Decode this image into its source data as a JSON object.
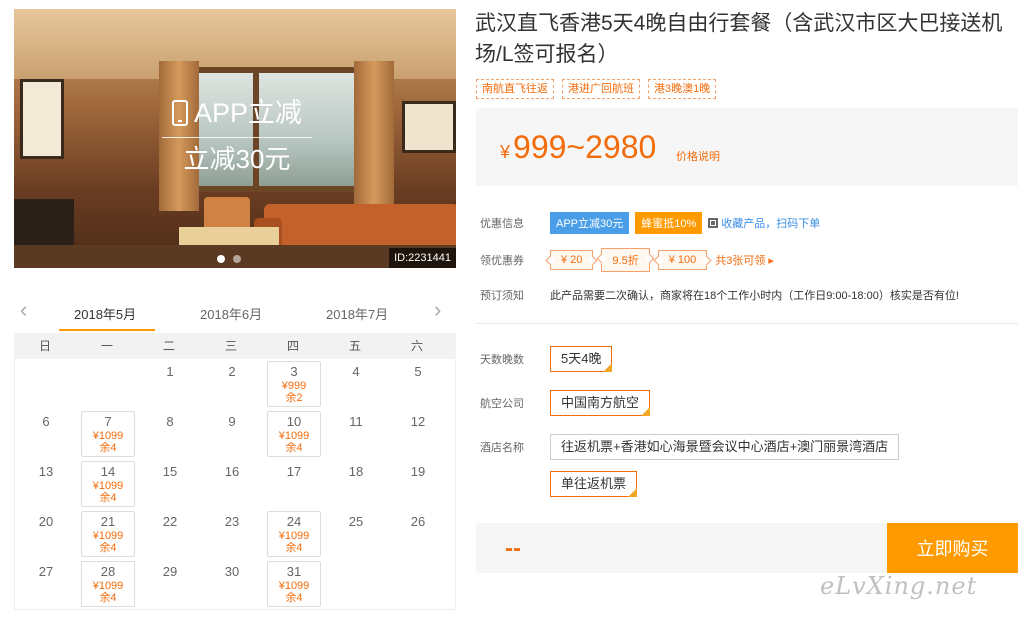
{
  "hero": {
    "promo_line1": "APP立减",
    "promo_line2": "立减30元",
    "product_id": "ID:2231441",
    "slides": 2,
    "active_slide": 0
  },
  "calendar": {
    "months": [
      "2018年5月",
      "2018年6月",
      "2018年7月"
    ],
    "active_month": 0,
    "weekdays": [
      "日",
      "一",
      "二",
      "三",
      "四",
      "五",
      "六"
    ],
    "days": [
      {
        "day": "",
        "price": "",
        "left": ""
      },
      {
        "day": "",
        "price": "",
        "left": ""
      },
      {
        "day": "1",
        "price": "",
        "left": ""
      },
      {
        "day": "2",
        "price": "",
        "left": ""
      },
      {
        "day": "3",
        "price": "¥999",
        "left": "余2"
      },
      {
        "day": "4",
        "price": "",
        "left": ""
      },
      {
        "day": "5",
        "price": "",
        "left": ""
      },
      {
        "day": "6",
        "price": "",
        "left": ""
      },
      {
        "day": "7",
        "price": "¥1099",
        "left": "余4"
      },
      {
        "day": "8",
        "price": "",
        "left": ""
      },
      {
        "day": "9",
        "price": "",
        "left": ""
      },
      {
        "day": "10",
        "price": "¥1099",
        "left": "余4"
      },
      {
        "day": "11",
        "price": "",
        "left": ""
      },
      {
        "day": "12",
        "price": "",
        "left": ""
      },
      {
        "day": "13",
        "price": "",
        "left": ""
      },
      {
        "day": "14",
        "price": "¥1099",
        "left": "余4"
      },
      {
        "day": "15",
        "price": "",
        "left": ""
      },
      {
        "day": "16",
        "price": "",
        "left": ""
      },
      {
        "day": "17",
        "price": "",
        "left": ""
      },
      {
        "day": "18",
        "price": "",
        "left": ""
      },
      {
        "day": "19",
        "price": "",
        "left": ""
      },
      {
        "day": "20",
        "price": "",
        "left": ""
      },
      {
        "day": "21",
        "price": "¥1099",
        "left": "余4"
      },
      {
        "day": "22",
        "price": "",
        "left": ""
      },
      {
        "day": "23",
        "price": "",
        "left": ""
      },
      {
        "day": "24",
        "price": "¥1099",
        "left": "余4"
      },
      {
        "day": "25",
        "price": "",
        "left": ""
      },
      {
        "day": "26",
        "price": "",
        "left": ""
      },
      {
        "day": "27",
        "price": "",
        "left": ""
      },
      {
        "day": "28",
        "price": "¥1099",
        "left": "余4"
      },
      {
        "day": "29",
        "price": "",
        "left": ""
      },
      {
        "day": "30",
        "price": "",
        "left": ""
      },
      {
        "day": "31",
        "price": "¥1099",
        "left": "余4"
      },
      {
        "day": "",
        "price": "",
        "left": ""
      },
      {
        "day": "",
        "price": "",
        "left": ""
      }
    ]
  },
  "product": {
    "title": "武汉直飞香港5天4晚自由行套餐（含武汉市区大巴接送机场/L签可报名）",
    "tags": [
      "南航直飞往返",
      "港进广回航班",
      "港3晚澳1晚"
    ],
    "price_currency": "¥",
    "price_range": "999~2980",
    "price_explain": "价格说明"
  },
  "offers": {
    "label": "优惠信息",
    "badge_app": "APP立减30元",
    "badge_honey": "蜂蜜抵10%",
    "collect": "收藏产品，扫码下单"
  },
  "coupons": {
    "label": "领优惠券",
    "items": [
      "¥ 20",
      "9.5折",
      "¥ 100"
    ],
    "more": "共3张可领 ▸"
  },
  "booking": {
    "label": "预订须知",
    "text": "此产品需要二次确认，商家将在18个工作小时内（工作日9:00-18:00）核实是否有位!"
  },
  "options": {
    "days_label": "天数晚数",
    "days_value": "5天4晚",
    "airline_label": "航空公司",
    "airline_value": "中国南方航空",
    "hotel_label": "酒店名称",
    "hotel_option1": "往返机票+香港如心海景暨会议中心酒店+澳门丽景湾酒店",
    "hotel_option2": "单往返机票"
  },
  "buy": {
    "total": "--",
    "button": "立即购买"
  },
  "watermark": "eLvXing.net",
  "colors": {
    "accent": "#f36c0c",
    "button": "#ff9a00",
    "blue_badge": "#4a9ee8"
  }
}
